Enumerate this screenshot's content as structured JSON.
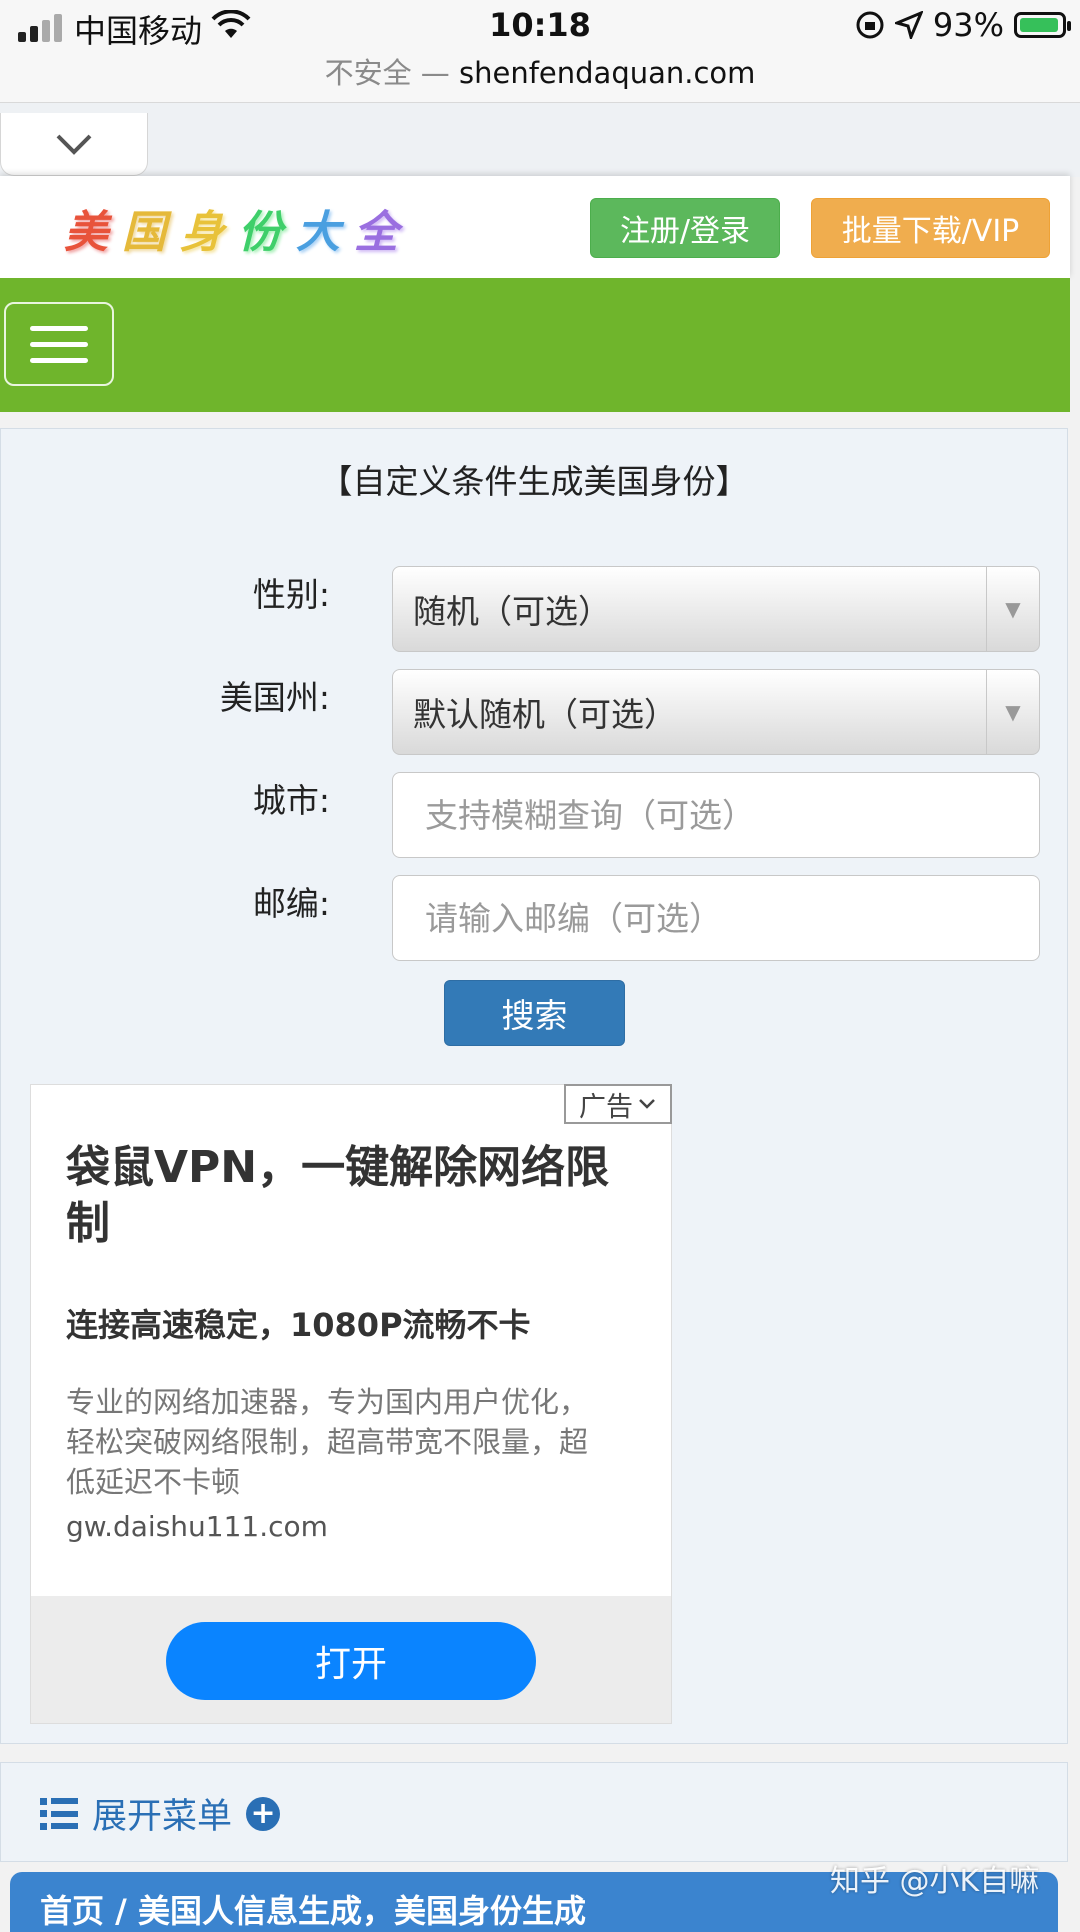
{
  "status_bar": {
    "carrier": "中国移动",
    "time": "10:18",
    "battery": "93%",
    "url_insecure": "不安全 —",
    "url_host": "shenfendaquan.com"
  },
  "header": {
    "logo_chars": [
      "美",
      "国",
      "身",
      "份",
      "大",
      "全"
    ],
    "login_label": "注册/登录",
    "vip_label": "批量下载/VIP"
  },
  "form": {
    "title": "【自定义条件生成美国身份】",
    "gender_label": "性别:",
    "gender_value": "随机（可选）",
    "state_label": "美国州:",
    "state_value": "默认随机（可选）",
    "city_label": "城市:",
    "city_placeholder": "支持模糊查询（可选）",
    "zip_label": "邮编:",
    "zip_placeholder": "请输入邮编（可选）",
    "search_label": "搜索"
  },
  "ad": {
    "badge": "广告",
    "headline": "袋鼠VPN，一键解除网络限制",
    "subheadline": "连接高速稳定，1080P流畅不卡",
    "description": "专业的网络加速器，专为国内用户优化，轻松突破网络限制，超高带宽不限量，超低延迟不卡顿",
    "url": "gw.daishu111.com",
    "open_label": "打开"
  },
  "menu": {
    "expand_label": "展开菜单"
  },
  "breadcrumb": {
    "text": "首页 / 美国人信息生成，美国身份生成"
  },
  "watermark": "知乎 @小K自嘛",
  "colors": {
    "nav_green": "#6fb52c",
    "login_green": "#5cb85c",
    "vip_orange": "#f0ad4e",
    "search_blue": "#337ab7",
    "ad_open_blue": "#0a84ff"
  }
}
